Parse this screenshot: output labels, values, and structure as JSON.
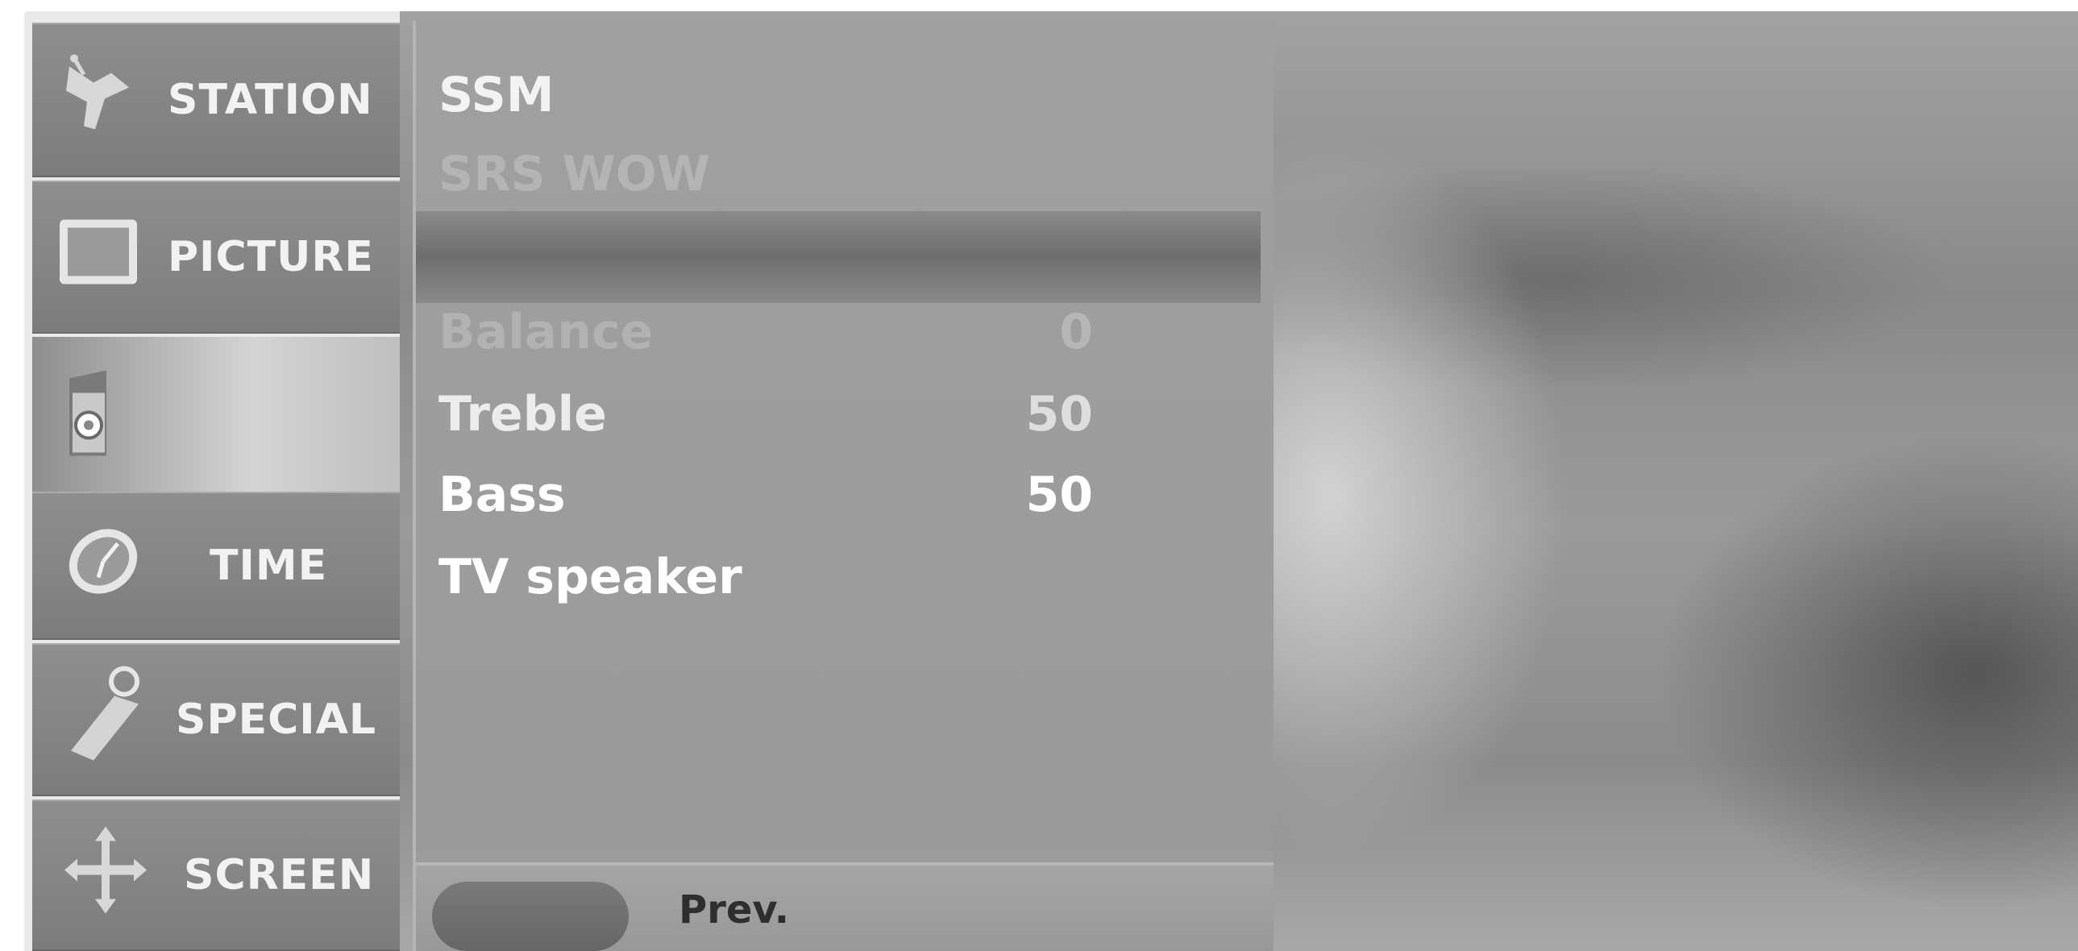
{
  "left_menu": {
    "items": [
      {
        "label": "STATION",
        "icon": "satellite-dish-icon"
      },
      {
        "label": "PICTURE",
        "icon": "tv-screen-icon"
      },
      {
        "label": "",
        "icon": "speaker-icon"
      },
      {
        "label": "TIME",
        "icon": "clock-icon"
      },
      {
        "label": "SPECIAL",
        "icon": "tag-icon"
      },
      {
        "label": "SCREEN",
        "icon": "move-arrows-icon"
      }
    ],
    "selected_index": 2
  },
  "sound_menu": {
    "rows": [
      {
        "label": "SSM",
        "value": ""
      },
      {
        "label": "SRS WOW",
        "value": ""
      },
      {
        "label": "",
        "value": ""
      },
      {
        "label": "Balance",
        "value": "0"
      },
      {
        "label": "Treble",
        "value": "50"
      },
      {
        "label": "Bass",
        "value": "50"
      },
      {
        "label": "TV speaker",
        "value": ""
      }
    ],
    "selected_index": 2
  },
  "footer": {
    "prev_label": "Prev."
  },
  "colors": {
    "menu_item_bg": "#858585",
    "panel_bg": "#9c9c9c",
    "selection_bar": "#6e6e6e",
    "text": "#f3f3f3"
  }
}
